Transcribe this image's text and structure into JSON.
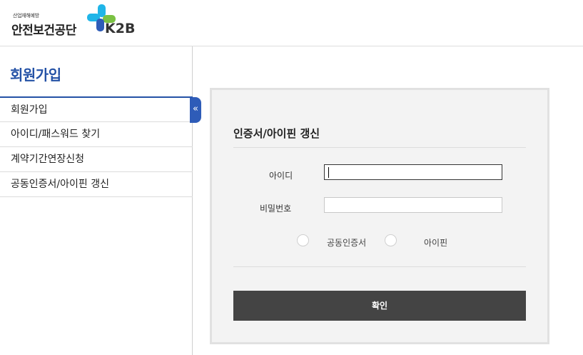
{
  "header": {
    "logo_small": "산업재해예방",
    "logo_main": "안전보건공단",
    "logo_brand": "K2B",
    "logo_colors": {
      "cyan": "#1fb5e8",
      "green": "#7ac143",
      "blue": "#2e5cb8"
    }
  },
  "sidebar": {
    "title": "회원가입",
    "items": [
      {
        "label": "회원가입"
      },
      {
        "label": "아이디/패스워드 찾기"
      },
      {
        "label": "계약기간연장신청"
      },
      {
        "label": "공동인증서/아이핀 갱신"
      }
    ],
    "collapse_icon": "double-chevron-left-icon",
    "accent_color": "#2452a6"
  },
  "form": {
    "title": "인증서/아이핀 갱신",
    "id_label": "아이디",
    "id_value": "",
    "password_label": "비밀번호",
    "password_value": "",
    "radio_cert_label": "공동인증서",
    "radio_ipin_label": "아이핀",
    "confirm_label": "확인",
    "confirm_color": "#444444"
  }
}
